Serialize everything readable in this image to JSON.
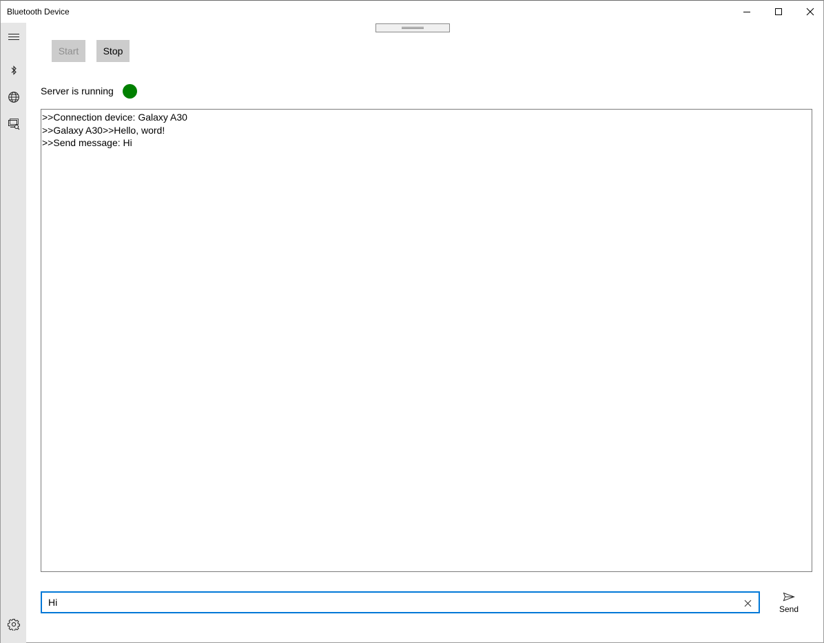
{
  "window": {
    "title": "Bluetooth Device"
  },
  "rail": {
    "items": [
      {
        "icon": "hamburger-menu-icon"
      },
      {
        "icon": "bluetooth-icon"
      },
      {
        "icon": "globe-icon"
      },
      {
        "icon": "remote-devices-icon"
      },
      {
        "icon": "settings-gear-icon"
      }
    ]
  },
  "toolbar": {
    "start_label": "Start",
    "start_enabled": false,
    "stop_label": "Stop"
  },
  "server": {
    "status_text": "Server is running",
    "status_color": "#008000"
  },
  "log": {
    "lines": [
      ">>Connection device: Galaxy A30",
      ">>Galaxy A30>>Hello, word!",
      ">>Send message: Hi"
    ]
  },
  "message": {
    "value": "Hi"
  },
  "send": {
    "label": "Send"
  },
  "colors": {
    "accent": "#0078d7",
    "rail_bg": "#e6e6e6",
    "button_bg": "#cccccc"
  }
}
